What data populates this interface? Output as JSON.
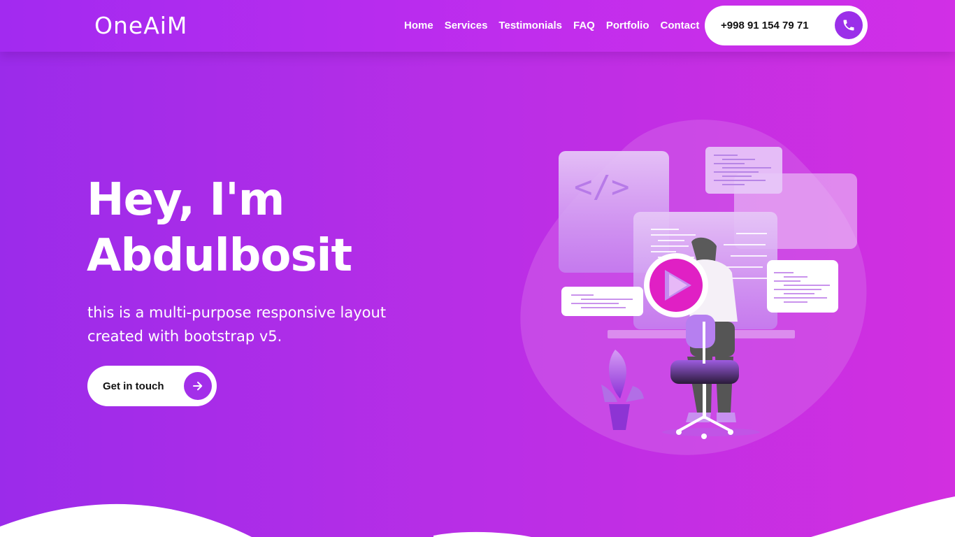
{
  "brand": {
    "name": "OneAiM"
  },
  "nav": {
    "links": [
      "Home",
      "Services",
      "Testimonials",
      "FAQ",
      "Portfolio",
      "Contact"
    ],
    "phone": "+998 91 154 79 71"
  },
  "hero": {
    "title_line1": "Hey, I'm",
    "title_line2": "Abdulbosit",
    "subtitle_line1": "this is a multi-purpose responsive layout",
    "subtitle_line2": "created with bootstrap v5.",
    "cta_label": "Get in touch"
  },
  "illustration": {
    "code_symbol": "</>"
  },
  "icons": {
    "phone": "phone-icon",
    "arrow": "arrow-right-icon",
    "play": "play-icon"
  },
  "colors": {
    "accent": "#9b2fe9",
    "gradient_start": "#9b2bea",
    "gradient_end": "#d22fe0",
    "play_pink": "#e020c4"
  }
}
